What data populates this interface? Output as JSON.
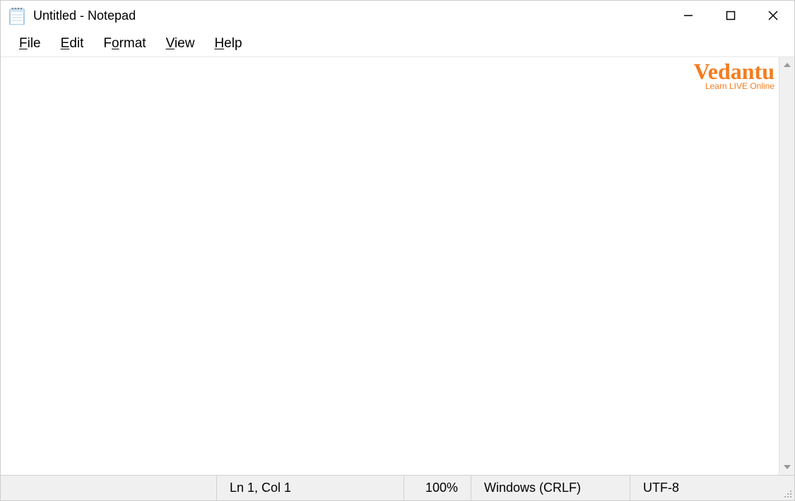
{
  "titlebar": {
    "title": "Untitled - Notepad"
  },
  "menubar": {
    "items": [
      {
        "label": "File",
        "accel_index": 0
      },
      {
        "label": "Edit",
        "accel_index": 0
      },
      {
        "label": "Format",
        "accel_index": 1
      },
      {
        "label": "View",
        "accel_index": 0
      },
      {
        "label": "Help",
        "accel_index": 0
      }
    ]
  },
  "editor": {
    "content": ""
  },
  "statusbar": {
    "position": "Ln 1, Col 1",
    "zoom": "100%",
    "line_ending": "Windows (CRLF)",
    "encoding": "UTF-8"
  },
  "watermark": {
    "brand": "Vedantu",
    "tagline": "Learn LIVE Online"
  },
  "colors": {
    "accent": "#f47c1f",
    "border": "#d0d0d0",
    "status_bg": "#f0f0f0"
  }
}
